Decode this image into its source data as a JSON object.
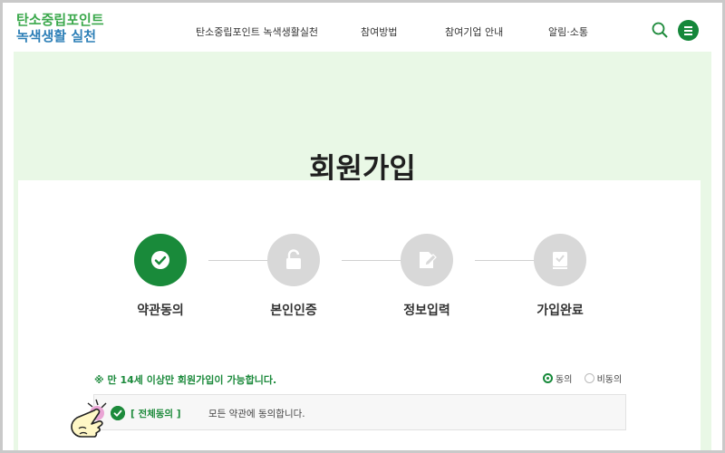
{
  "header": {
    "logo_line1": "탄소중립포인트",
    "logo_line2": "녹색생활 실천",
    "nav": [
      {
        "label": "탄소중립포인트 녹색생활실천"
      },
      {
        "label": "참여방법"
      },
      {
        "label": "참여기업 안내"
      },
      {
        "label": "알림·소통"
      }
    ],
    "icons": {
      "search": "search-icon",
      "menu": "hamburger-icon"
    }
  },
  "page": {
    "title": "회원가입"
  },
  "steps": [
    {
      "label": "약관동의",
      "state": "active",
      "icon": "check-icon"
    },
    {
      "label": "본인인증",
      "state": "pending",
      "icon": "unlock-icon"
    },
    {
      "label": "정보입력",
      "state": "pending",
      "icon": "edit-icon"
    },
    {
      "label": "가입완료",
      "state": "pending",
      "icon": "clipboard-check-icon"
    }
  ],
  "notice": "※ 만 14세 이상만 회원가입이 가능합니다.",
  "consent": {
    "options": [
      {
        "label": "동의",
        "selected": true
      },
      {
        "label": "비동의",
        "selected": false
      }
    ],
    "all_agree_tag": "[ 전체동의 ]",
    "all_agree_text": "모든 약관에 동의합니다."
  },
  "colors": {
    "brand_green": "#198a3a",
    "logo_blue": "#2d7fb7",
    "hero_bg": "#e9f8e6",
    "inactive_step": "#d8d8d8"
  }
}
